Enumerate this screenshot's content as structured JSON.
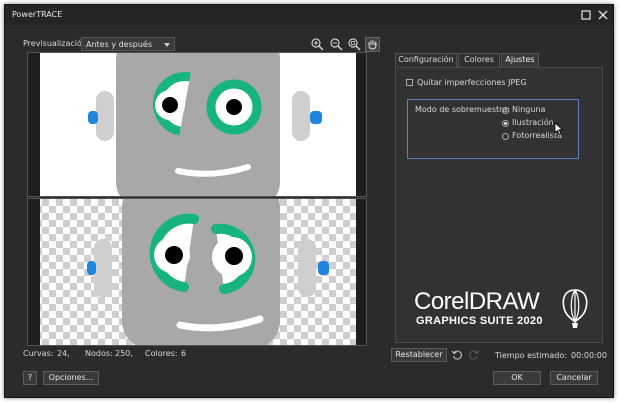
{
  "window": {
    "title": "PowerTRACE",
    "maximize_icon": "maximize-icon",
    "close_icon": "close-icon"
  },
  "preview": {
    "label": "Previsualización:",
    "mode_value": "Antes y después",
    "tools": [
      "zoom-in-icon",
      "zoom-out-icon",
      "zoom-fit-icon",
      "pan-hand-icon"
    ]
  },
  "tabs": [
    {
      "label": "Configuración",
      "active": false
    },
    {
      "label": "Colores",
      "active": false
    },
    {
      "label": "Ajustes",
      "active": true
    }
  ],
  "settings": {
    "jpeg_checkbox_label": "Quitar imperfecciones JPEG",
    "jpeg_checked": false,
    "resample_label": "Modo de sobremuestra:",
    "options": [
      {
        "label": "Ninguna",
        "selected": false
      },
      {
        "label": "Ilustración",
        "selected": true
      },
      {
        "label": "Fotorrealista",
        "selected": false
      }
    ]
  },
  "branding": {
    "line1": "CorelDRAW",
    "line2": "GRAPHICS SUITE 2020"
  },
  "stats": {
    "curves_label": "Curvas:",
    "curves_value": "24,",
    "nodes_label": "Nodos:",
    "nodes_value": "250,",
    "colors_label": "Colores:",
    "colors_value": "6"
  },
  "bottom": {
    "reset_label": "Restablecer",
    "estimated_label": "Tiempo estimado:",
    "estimated_value": "00:00:00",
    "help_label": "?",
    "options_label": "Opciones...",
    "ok_label": "OK",
    "cancel_label": "Cancelar"
  },
  "colors": {
    "accent": "#5b7fc9",
    "green": "#17b57d",
    "background": "#2b2b2b"
  }
}
